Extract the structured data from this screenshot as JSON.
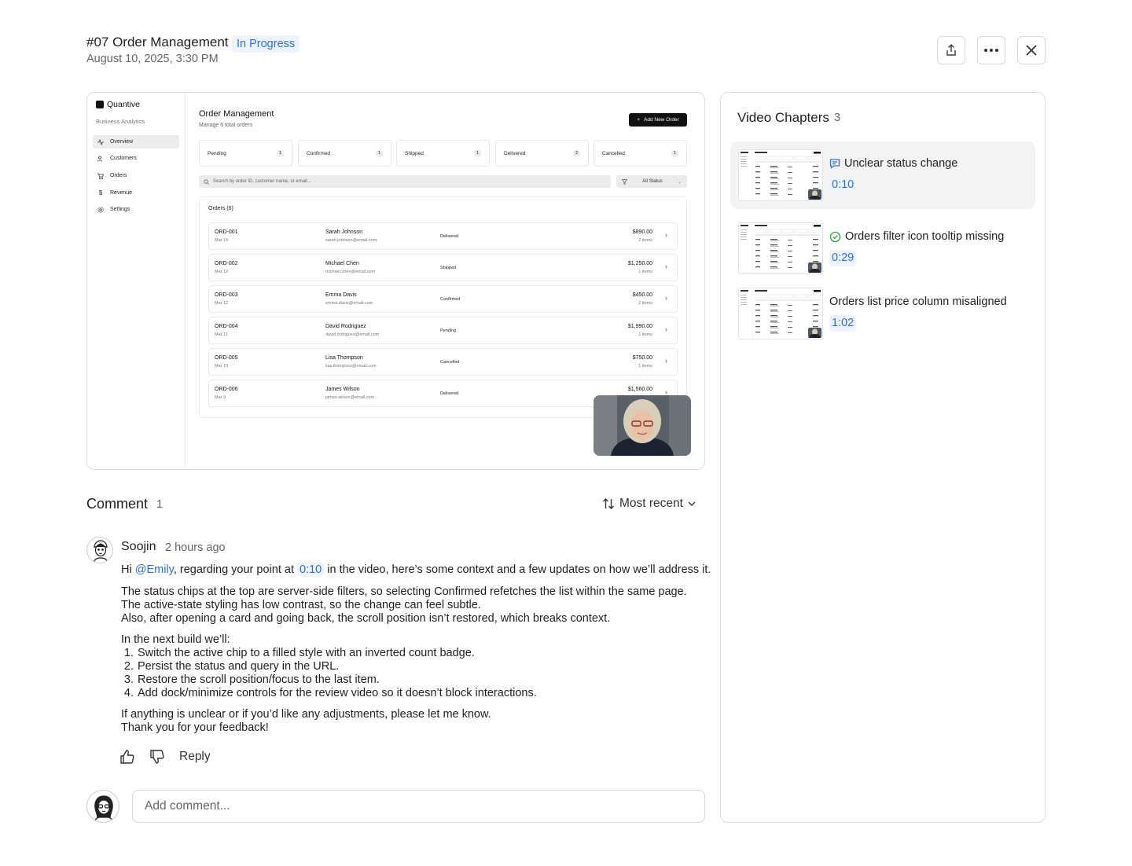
{
  "header": {
    "title": "#07 Order Management",
    "status": "In Progress",
    "date": "August 10, 2025, 3:30 PM"
  },
  "app": {
    "brand": "Quantive",
    "subtitle": "Business Analytics",
    "nav": [
      "Overview",
      "Customers",
      "Orders",
      "Revenue",
      "Settings"
    ],
    "page_title": "Order Management",
    "page_subtitle": "Manage 6 total orders",
    "add_button": "Add New Order",
    "chips": [
      {
        "label": "Pending",
        "count": "1"
      },
      {
        "label": "Confirmed",
        "count": "1"
      },
      {
        "label": "Shipped",
        "count": "1"
      },
      {
        "label": "Delivered",
        "count": "2"
      },
      {
        "label": "Cancelled",
        "count": "1"
      }
    ],
    "search_placeholder": "Search by order ID, customer name, or email...",
    "filter_label": "All Status",
    "orders_title": "Orders (6)",
    "orders": [
      {
        "id": "ORD-001",
        "date": "Mar 14",
        "name": "Sarah Johnson",
        "email": "sarah.johnson@email.com",
        "status": "Delivered",
        "price": "$890.00",
        "items": "2 items"
      },
      {
        "id": "ORD-002",
        "date": "Mar 13",
        "name": "Michael Chen",
        "email": "michael.chen@email.com",
        "status": "Shipped",
        "price": "$1,250.00",
        "items": "1 items"
      },
      {
        "id": "ORD-003",
        "date": "Mar 12",
        "name": "Emma Davis",
        "email": "emma.davis@email.com",
        "status": "Confirmed",
        "price": "$450.00",
        "items": "2 items"
      },
      {
        "id": "ORD-004",
        "date": "Mar 11",
        "name": "David Rodriguez",
        "email": "david.rodriguez@email.com",
        "status": "Pending",
        "price": "$1,990.00",
        "items": "1 items"
      },
      {
        "id": "ORD-005",
        "date": "Mar 10",
        "name": "Lisa Thompson",
        "email": "lisa.thompson@email.com",
        "status": "Cancelled",
        "price": "$750.00",
        "items": "1 items"
      },
      {
        "id": "ORD-006",
        "date": "Mar 9",
        "name": "James Wilson",
        "email": "james.wilson@email.com",
        "status": "Delivered",
        "price": "$1,560.00",
        "items": ""
      }
    ]
  },
  "chapters": {
    "title": "Video Chapters",
    "count": "3",
    "items": [
      {
        "title": "Unclear status change",
        "time": "0:10",
        "icon": "comment-icon",
        "active": true
      },
      {
        "title": "Orders filter icon tooltip missing",
        "time": "0:29",
        "icon": "check-circle-icon",
        "active": false
      },
      {
        "title": "Orders list price column misaligned",
        "time": "1:02",
        "icon": "",
        "active": false
      }
    ]
  },
  "comments": {
    "title": "Comment",
    "count": "1",
    "sort_label": "Most recent",
    "author": "Soojin",
    "ago": "2 hours ago",
    "line1_pre": "Hi ",
    "mention": "@Emily",
    "line1_mid": ", regarding your point at ",
    "timestamp": "0:10",
    "line1_post": " in the video, here’s some context and a few updates on how we’ll address it.",
    "para2": [
      "The status chips at the top are server-side filters, so selecting Confirmed refetches the list within the same page.",
      "The active-state styling has low contrast, so the change can feel subtle.",
      "Also, after opening a card and going back, the scroll position isn’t restored, which breaks context."
    ],
    "para3_intro": "In the next build we’ll:",
    "list": [
      "Switch the active chip to a filled style with an inverted count badge.",
      "Persist the status and query in the URL.",
      "Restore the scroll position/focus to the last item.",
      "Add dock/minimize controls for the review video so it doesn’t block interactions."
    ],
    "para4": [
      "If anything is unclear or if you’d like any adjustments, please let me know.",
      "Thank you for your feedback!"
    ],
    "reply_label": "Reply",
    "add_placeholder": "Add comment..."
  },
  "colors": {
    "accent": "#2f6fe0",
    "accent_bg": "#eef4fd",
    "success": "#2e9e48"
  }
}
